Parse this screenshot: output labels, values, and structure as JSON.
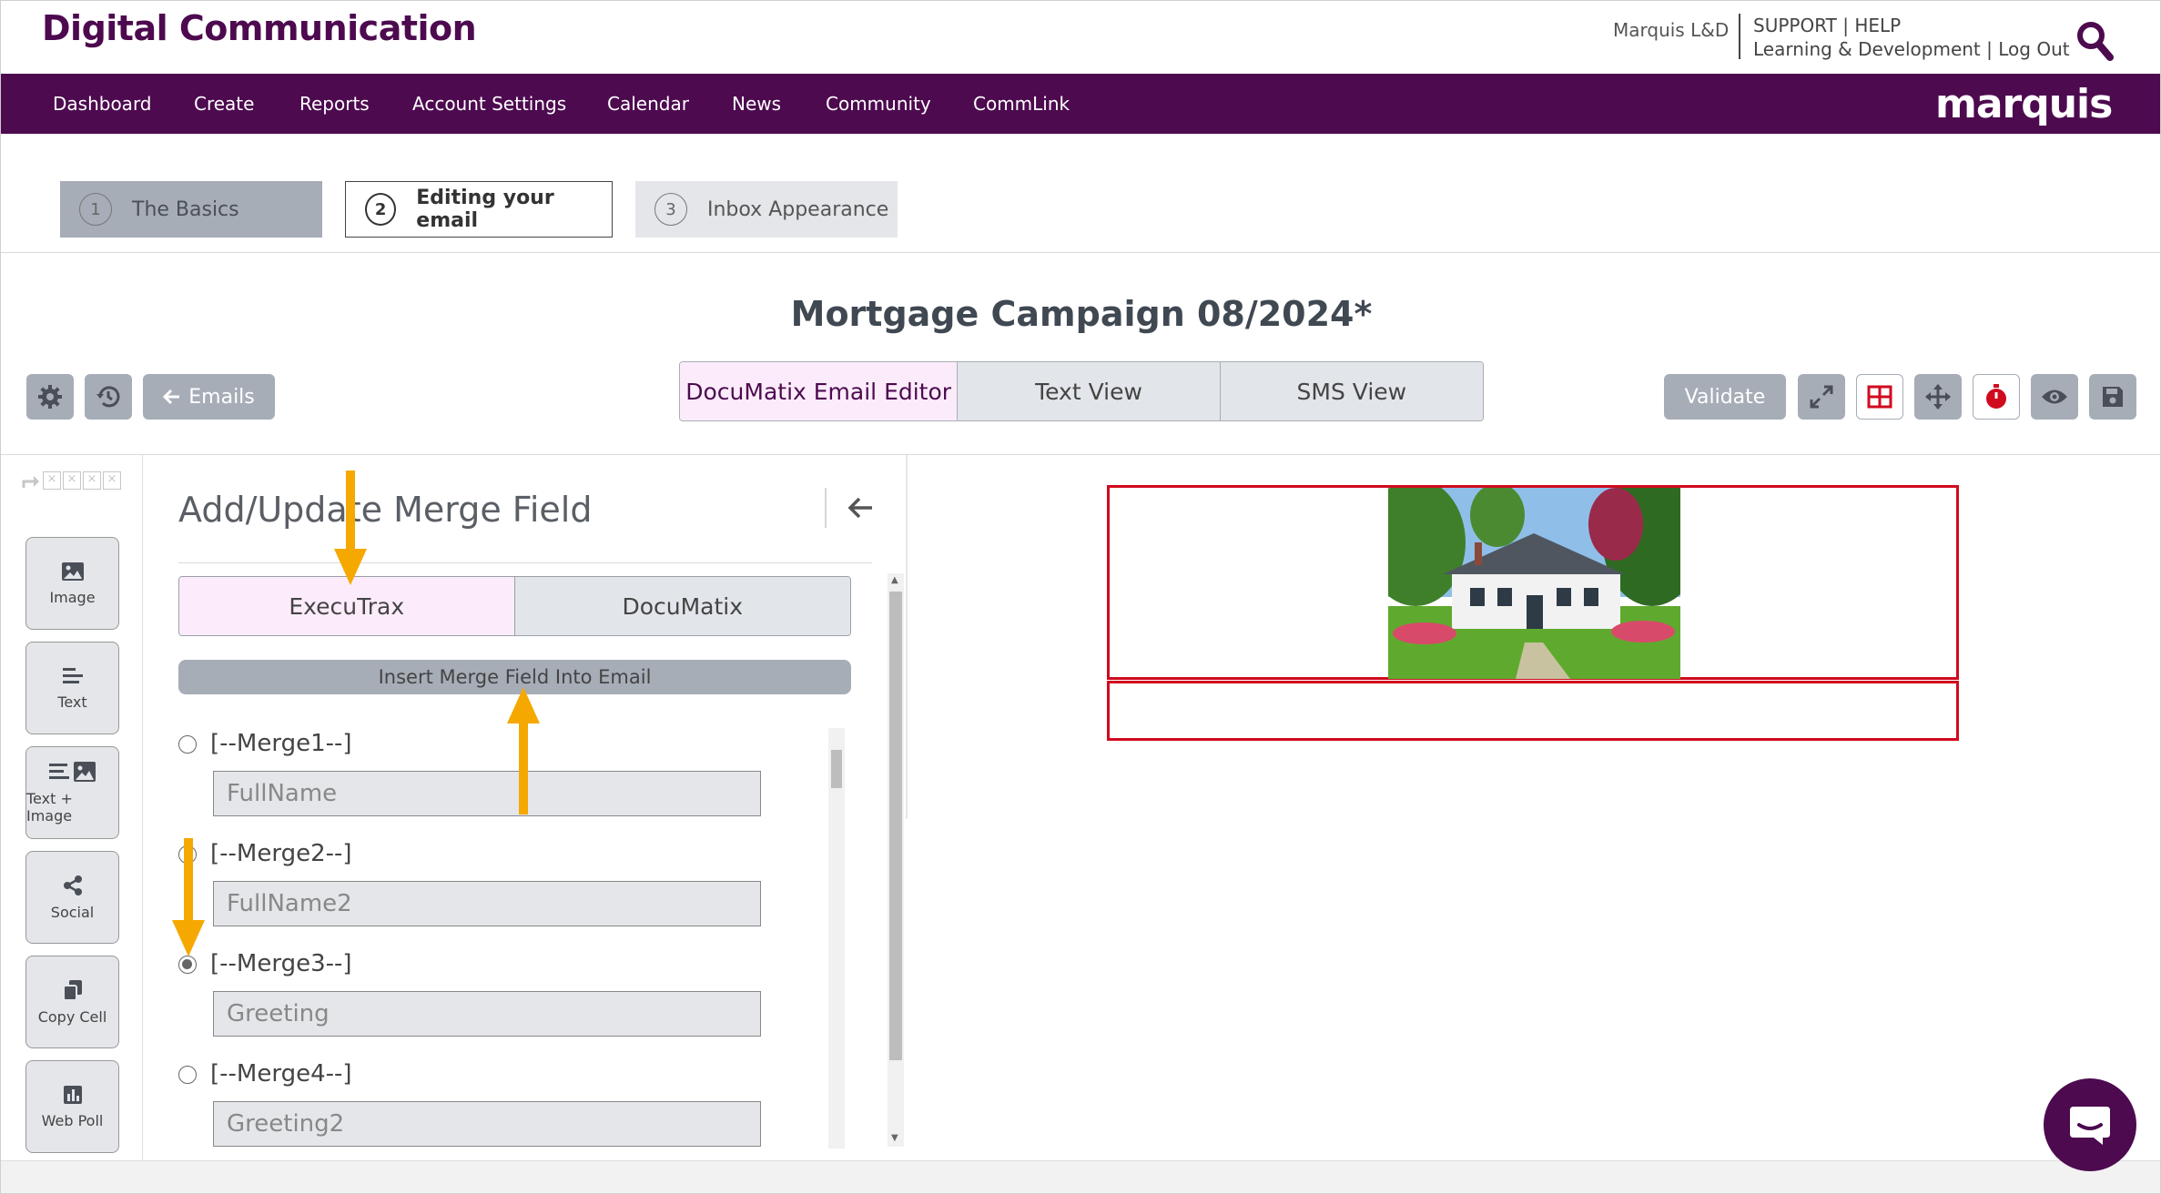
{
  "header": {
    "brand": "Digital Communication",
    "user": "Marquis L&D",
    "support": "SUPPORT",
    "help": "HELP",
    "org": "Learning & Development",
    "logout": "Log Out",
    "sep": "|"
  },
  "nav": {
    "items": [
      "Dashboard",
      "Create",
      "Reports",
      "Account Settings",
      "Calendar",
      "News",
      "Community",
      "CommLink"
    ],
    "logo": "marquis"
  },
  "steps": [
    {
      "num": "1",
      "label": "The Basics"
    },
    {
      "num": "2",
      "label": "Editing your email"
    },
    {
      "num": "3",
      "label": "Inbox Appearance"
    }
  ],
  "campaign": {
    "title": "Mortgage Campaign 08/2024*"
  },
  "toolbar": {
    "emails_label": "Emails",
    "view_tabs": [
      "DocuMatix Email Editor",
      "Text View",
      "SMS View"
    ],
    "active_view": "DocuMatix Email Editor",
    "validate_label": "Validate"
  },
  "blocks": [
    "Image",
    "Text",
    "Text + Image",
    "Social",
    "Copy Cell",
    "Web Poll"
  ],
  "merge_panel": {
    "title": "Add/Update Merge Field",
    "source_tabs": [
      "ExecuTrax",
      "DocuMatix"
    ],
    "active_source": "ExecuTrax",
    "insert_label": "Insert Merge Field Into Email",
    "fields": [
      {
        "tag": "[--Merge1--]",
        "value": "FullName",
        "selected": false
      },
      {
        "tag": "[--Merge2--]",
        "value": "FullName2",
        "selected": false
      },
      {
        "tag": "[--Merge3--]",
        "value": "Greeting",
        "selected": true
      },
      {
        "tag": "[--Merge4--]",
        "value": "Greeting2",
        "selected": false
      }
    ]
  },
  "colors": {
    "brand_purple": "#4d0a4f",
    "button_gray": "#a6adb7",
    "active_tab_pink": "#fcecfb",
    "outline_red": "#d10a1e",
    "annotation_orange": "#f5a800"
  }
}
